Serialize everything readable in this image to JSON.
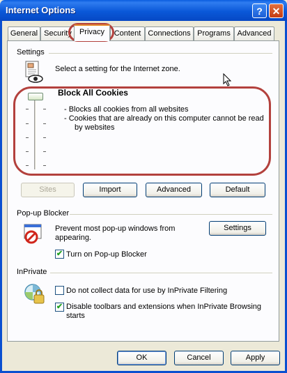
{
  "window": {
    "title": "Internet Options",
    "help": "?",
    "close": "✕"
  },
  "tabs": [
    "General",
    "Security",
    "Privacy",
    "Content",
    "Connections",
    "Programs",
    "Advanced"
  ],
  "settings": {
    "label": "Settings",
    "description": "Select a setting for the Internet zone.",
    "level_title": "Block All Cookies",
    "bullet1": "- Blocks all cookies from all websites",
    "bullet2": "- Cookies that are already on this computer cannot be read",
    "bullet3": "by websites",
    "slider_level": "6 of 6 (top)"
  },
  "buttons": {
    "sites": "Sites",
    "import": "Import",
    "advanced": "Advanced",
    "default": "Default",
    "popup_settings": "Settings",
    "ok": "OK",
    "cancel": "Cancel",
    "apply": "Apply"
  },
  "popup": {
    "label": "Pop-up Blocker",
    "description1": "Prevent most pop-up windows from",
    "description2": "appearing.",
    "turn_on": "Turn on Pop-up Blocker",
    "turn_on_checked": true
  },
  "inprivate": {
    "label": "InPrivate",
    "no_collect": "Do not collect data for use by InPrivate Filtering",
    "no_collect_checked": false,
    "disable_toolbars1": "Disable toolbars and extensions when InPrivate Browsing",
    "disable_toolbars2": "starts",
    "disable_toolbars_checked": true
  },
  "colors": {
    "annotation": "#b3413d",
    "titlebar": "#0a58d8"
  }
}
